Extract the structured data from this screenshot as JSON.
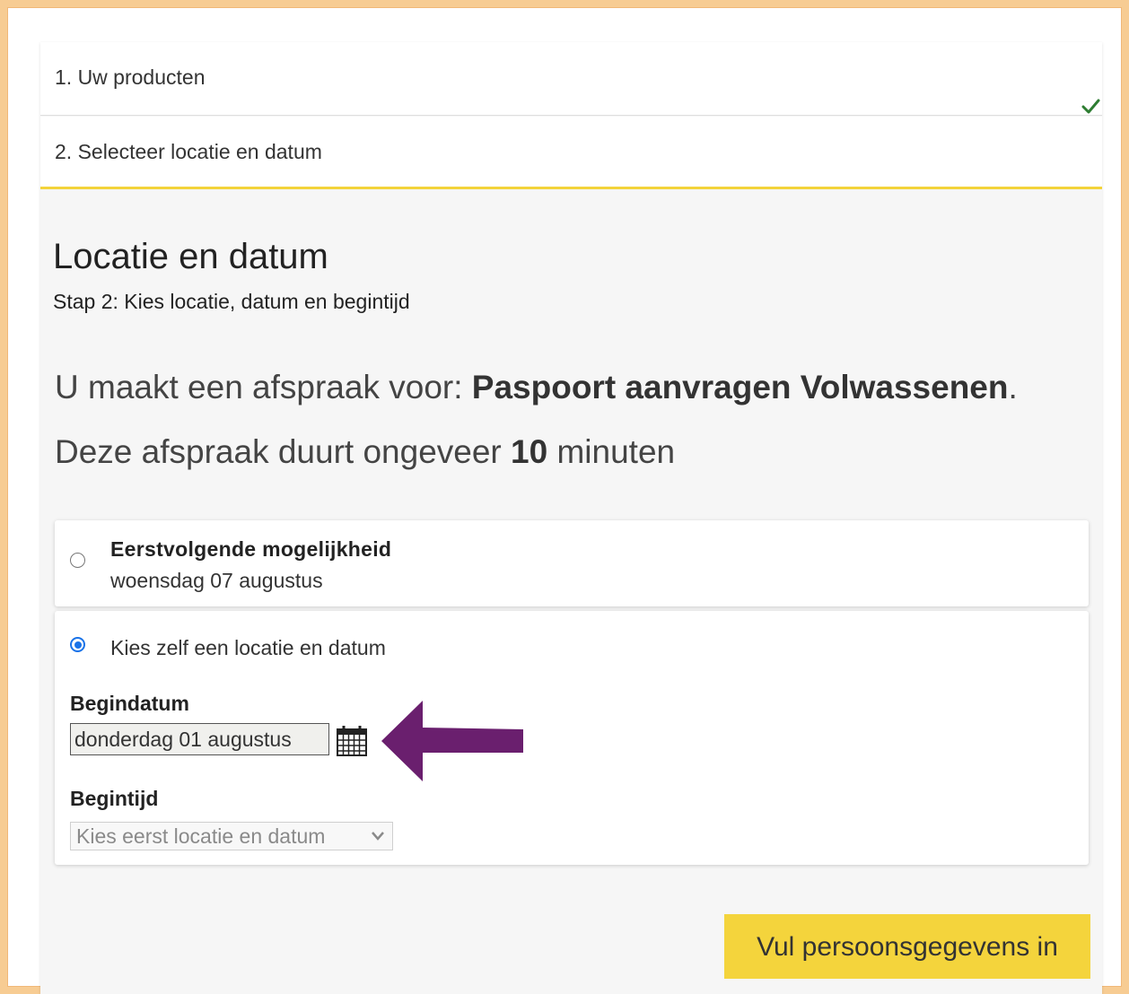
{
  "steps": [
    {
      "label": "1. Uw producten",
      "completed": true
    },
    {
      "label": "2. Selecteer locatie en datum",
      "completed": false
    }
  ],
  "page": {
    "title": "Locatie en datum",
    "subtitle": "Stap 2: Kies locatie, datum en begintijd"
  },
  "appointment": {
    "prefix": "U maakt een afspraak voor: ",
    "product": "Paspoort aanvragen Volwassenen",
    "suffix": ".",
    "duration_prefix": "Deze afspraak duurt ongeveer ",
    "duration_value": "10",
    "duration_suffix": " minuten"
  },
  "options": {
    "first": {
      "title": "Eerstvolgende mogelijkheid",
      "date": "woensdag 07 augustus",
      "selected": false
    },
    "custom": {
      "label": "Kies zelf een locatie en datum",
      "selected": true,
      "start_date_label": "Begindatum",
      "start_date_value": "donderdag 01 augustus",
      "start_time_label": "Begintijd",
      "start_time_placeholder": "Kies eerst locatie en datum"
    }
  },
  "actions": {
    "next_label": "Vul persoonsgegevens in"
  },
  "colors": {
    "accent_yellow": "#f4d43c",
    "annotation_arrow": "#6a1f6e",
    "frame_border": "#f7cc93",
    "check_green": "#2e7d32",
    "radio_blue": "#1a73e8"
  },
  "icons": [
    "check-icon",
    "calendar-icon",
    "arrow-icon",
    "chevron-down-icon"
  ]
}
